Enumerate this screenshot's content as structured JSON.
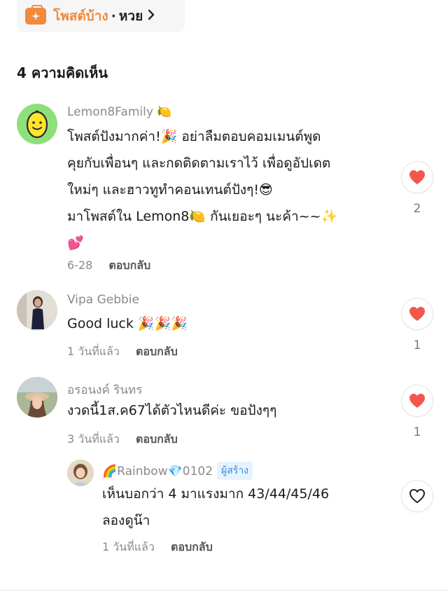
{
  "topic": {
    "name": "โพสต์บ้าง",
    "separator": "·",
    "sub": "หวย"
  },
  "comments_count_label": "4 ความคิดเห็น",
  "comments": [
    {
      "username": "Lemon8Family 🍋",
      "lines": [
        "โพสต์ปังมากค่า!🎉 อย่าลืมตอบคอมเมนต์พูด",
        "คุยกับเพื่อนๆ และกดติดตามเราไว้ เพื่อดูอัปเดต",
        "ใหม่ๆ และฮาวทูทำคอนเทนต์ปังๆ!😎",
        "มาโพสต์ใน Lemon8🍋 กันเยอะๆ นะค้า~~✨",
        "💕"
      ],
      "time": "6-28",
      "reply_label": "ตอบกลับ",
      "likes": "2",
      "liked": true
    },
    {
      "username": "Vipa Gebbie",
      "lines": [
        "Good luck 🎉🎉🎉"
      ],
      "time": "1 วันที่แล้ว",
      "reply_label": "ตอบกลับ",
      "likes": "1",
      "liked": true
    },
    {
      "username": "อรอนงค์ รินทร",
      "lines": [
        "งวดนี้1ส.ค67ได้ตัวไหนดีค่ะ ขอปังๆๆ"
      ],
      "time": "3 วันที่แล้ว",
      "reply_label": "ตอบกลับ",
      "likes": "1",
      "liked": true
    },
    {
      "username": "🌈Rainbow💎0102",
      "badge": "ผู้สร้าง",
      "lines": [
        "เห็นบอกว่า 4 มาแรงมาก 43/44/45/46",
        "ลองดูน๊า"
      ],
      "time": "1 วันที่แล้ว",
      "reply_label": "ตอบกลับ",
      "likes": "",
      "liked": false
    }
  ],
  "icons": {
    "topic": "sparkle-briefcase-icon",
    "chevron": "chevron-right-icon",
    "like": "heart-icon"
  },
  "colors": {
    "accent": "#f08a3c",
    "heart": "#f2564d",
    "badge_text": "#3b8be0",
    "badge_bg": "#e6f3ff"
  }
}
